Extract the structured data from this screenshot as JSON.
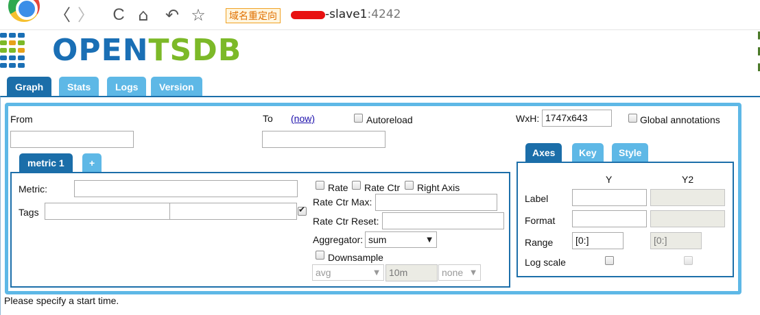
{
  "browser": {
    "back_glyph": "〈",
    "forward_glyph": "〉",
    "reload_glyph": "C",
    "home_glyph": "⌂",
    "undo_glyph": "↶",
    "star_glyph": "☆",
    "redirect_badge": "域名重定向",
    "host": "-slave1",
    "port": ":4242",
    "icons": [
      "browser-logo-icon",
      "back-icon",
      "forward-icon",
      "reload-icon",
      "home-icon",
      "undo-icon",
      "bookmark-star-icon"
    ]
  },
  "logo": {
    "open": "OPEN",
    "tsdb": "TSDB",
    "colors": {
      "blue": "#1a6fb5",
      "green": "#7cb928"
    }
  },
  "tabs": [
    "Graph",
    "Stats",
    "Logs",
    "Version"
  ],
  "active_tab": "Graph",
  "time": {
    "from_label": "From",
    "from_value": "",
    "to_label": "To",
    "now_link": "(now)",
    "to_value": "",
    "autoreload_label": "Autoreload",
    "autoreload_checked": false
  },
  "size": {
    "label": "WxH:",
    "value": "1747x643",
    "global_annotations_label": "Global annotations",
    "global_annotations_checked": false
  },
  "metric_tabs": [
    "metric 1",
    "+"
  ],
  "metric": {
    "metric_label": "Metric:",
    "metric_value": "",
    "tags_label": "Tags",
    "tag_key": "",
    "tag_value": "",
    "tag_group_checked": true,
    "rate_label": "Rate",
    "rate_ctr_label": "Rate Ctr",
    "right_axis_label": "Right Axis",
    "rate_ctr_max_label": "Rate Ctr Max:",
    "rate_ctr_max_value": "",
    "rate_ctr_reset_label": "Rate Ctr Reset:",
    "rate_ctr_reset_value": "",
    "aggregator_label": "Aggregator:",
    "aggregator_value": "sum",
    "downsample_label": "Downsample",
    "downsample_checked": false,
    "downsample_function": "avg",
    "downsample_interval": "10m",
    "downsample_fill": "none"
  },
  "axes_tabs": [
    "Axes",
    "Key",
    "Style"
  ],
  "axes": {
    "col_y": "Y",
    "col_y2": "Y2",
    "label_row": "Label",
    "format_row": "Format",
    "range_row": "Range",
    "logscale_row": "Log scale",
    "y_label": "",
    "y2_label": "",
    "y_format": "",
    "y2_format": "",
    "y_range": "[0:]",
    "y2_range": "[0:]",
    "y_logscale": false,
    "y2_logscale": false
  },
  "status": "Please specify a start time.",
  "colors": {
    "tab_active": "#1b6ea9",
    "tab_inactive": "#5eb8e6",
    "panel_border": "#5eb8e6"
  }
}
